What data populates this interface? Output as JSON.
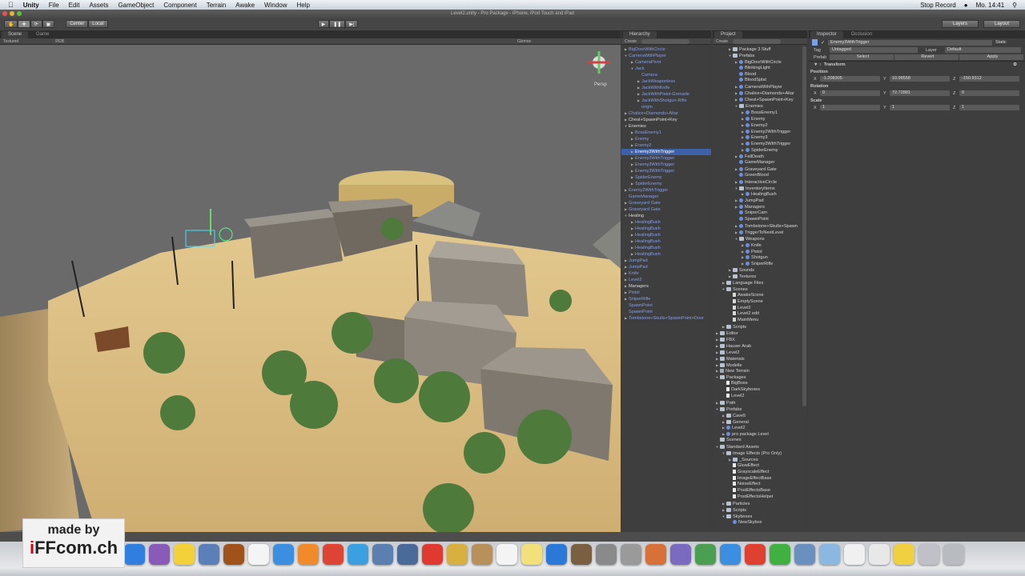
{
  "menubar": {
    "app": "Unity",
    "items": [
      "File",
      "Edit",
      "Assets",
      "GameObject",
      "Component",
      "Terrain",
      "Awake",
      "Window",
      "Help"
    ],
    "status": [
      "Stop Record",
      "Mo. 14:41"
    ]
  },
  "window": {
    "title": "Level2.unity - Pro Package - iPhone, iPod Touch and iPad"
  },
  "toolbar": {
    "pivot": "Center",
    "space": "Local",
    "layers": "Layers",
    "layout": "Layout"
  },
  "scene": {
    "tabs": [
      "Scene",
      "Game"
    ],
    "render_mode": "Textured",
    "color_mode": "RGB",
    "gizmos": "Gizmos",
    "persp": "Persp"
  },
  "hierarchy": {
    "title": "Hierarchy",
    "create": "Create",
    "items": [
      [
        0,
        "c",
        "BigDoorWithCircle",
        1
      ],
      [
        0,
        "o",
        "CameraWithPlayer",
        1
      ],
      [
        1,
        "c",
        "CameraPivot",
        1
      ],
      [
        1,
        "o",
        "Jack",
        1
      ],
      [
        2,
        "",
        "Camera",
        1
      ],
      [
        2,
        "c",
        "JackWeaponless",
        1
      ],
      [
        2,
        "c",
        "JackWithKnife",
        1
      ],
      [
        2,
        "c",
        "JackWithPistol-Grenade",
        1
      ],
      [
        2,
        "c",
        "JackWithShotgun-Rifle",
        1
      ],
      [
        2,
        "",
        "origin",
        1
      ],
      [
        0,
        "c",
        "Chalice+Diamonds+Altar",
        1
      ],
      [
        0,
        "c",
        "Chest+SpawnPoint+Key",
        0
      ],
      [
        0,
        "o",
        "Enemies",
        0
      ],
      [
        1,
        "c",
        "BossEnemy1",
        1
      ],
      [
        1,
        "c",
        "Enemy",
        1
      ],
      [
        1,
        "c",
        "Enemy2",
        1
      ],
      [
        1,
        "c",
        "Enemy3WithTrigger",
        2
      ],
      [
        1,
        "c",
        "Enemy3WithTrigger",
        1
      ],
      [
        1,
        "c",
        "Enemy3WithTrigger",
        1
      ],
      [
        1,
        "c",
        "Enemy3WithTrigger",
        1
      ],
      [
        1,
        "c",
        "SpiderEnemy",
        1
      ],
      [
        1,
        "c",
        "SpiderEnemy",
        1
      ],
      [
        0,
        "c",
        "Enemy2WithTrigger",
        1
      ],
      [
        0,
        "",
        "GameManager",
        1
      ],
      [
        0,
        "c",
        "Graveyard Gate",
        1
      ],
      [
        0,
        "c",
        "Graveyard Gate",
        1
      ],
      [
        0,
        "o",
        "Healing",
        0
      ],
      [
        1,
        "c",
        "HealingBush",
        1
      ],
      [
        1,
        "c",
        "HealingBush",
        1
      ],
      [
        1,
        "c",
        "HealingBush",
        1
      ],
      [
        1,
        "c",
        "HealingBush",
        1
      ],
      [
        1,
        "c",
        "HealingBush",
        1
      ],
      [
        1,
        "c",
        "HealingBush",
        1
      ],
      [
        0,
        "c",
        "JumpPad",
        1
      ],
      [
        0,
        "c",
        "JumpPad",
        1
      ],
      [
        0,
        "c",
        "Knife",
        1
      ],
      [
        0,
        "c",
        "Level2",
        1
      ],
      [
        0,
        "c",
        "Managers",
        0
      ],
      [
        0,
        "c",
        "Pistol",
        1
      ],
      [
        0,
        "c",
        "SniperRifle",
        1
      ],
      [
        0,
        "",
        "SpawnPoint",
        1
      ],
      [
        0,
        "",
        "SpawnPoint",
        1
      ],
      [
        0,
        "c",
        "Tombstone+Skulls+SpawnPoint+Door",
        1
      ]
    ]
  },
  "project": {
    "title": "Project",
    "create": "Create",
    "items": [
      [
        2,
        "c",
        "f",
        "Package 3 Stuff"
      ],
      [
        2,
        "o",
        "f",
        "Prefabs"
      ],
      [
        3,
        "c",
        "p",
        "BigDoorWithCircle"
      ],
      [
        3,
        "",
        "p",
        "BlinkingLight"
      ],
      [
        3,
        "",
        "p",
        "Blood"
      ],
      [
        3,
        "",
        "p",
        "BloodSplat"
      ],
      [
        3,
        "c",
        "p",
        "CameraWithPlayer"
      ],
      [
        3,
        "c",
        "p",
        "Chalice+Diamonds+Altar"
      ],
      [
        3,
        "c",
        "p",
        "Chest+SpawnPoint+Key"
      ],
      [
        3,
        "o",
        "f",
        "Enemies"
      ],
      [
        4,
        "c",
        "p",
        "BossEnemy1"
      ],
      [
        4,
        "c",
        "p",
        "Enemy"
      ],
      [
        4,
        "c",
        "p",
        "Enemy2"
      ],
      [
        4,
        "c",
        "p",
        "Enemy2WithTrigger"
      ],
      [
        4,
        "c",
        "p",
        "Enemy3"
      ],
      [
        4,
        "c",
        "p",
        "Enemy3WithTrigger"
      ],
      [
        4,
        "c",
        "p",
        "SpiderEnemy"
      ],
      [
        3,
        "c",
        "p",
        "FallDeath"
      ],
      [
        3,
        "",
        "p",
        "GameManager"
      ],
      [
        3,
        "c",
        "p",
        "Graveyard Gate"
      ],
      [
        3,
        "",
        "p",
        "GreenBlood"
      ],
      [
        3,
        "c",
        "p",
        "InteractiveCircle"
      ],
      [
        3,
        "o",
        "f",
        "InventoryItems"
      ],
      [
        4,
        "c",
        "p",
        "HealingBush"
      ],
      [
        3,
        "c",
        "p",
        "JumpPad"
      ],
      [
        3,
        "c",
        "p",
        "Managers"
      ],
      [
        3,
        "",
        "p",
        "SniperCam"
      ],
      [
        3,
        "",
        "p",
        "SpawnPoint"
      ],
      [
        3,
        "c",
        "p",
        "Tombstone+Skulls+Spawn"
      ],
      [
        3,
        "c",
        "p",
        "TriggerToNextLevel"
      ],
      [
        3,
        "o",
        "f",
        "Weapons"
      ],
      [
        4,
        "c",
        "p",
        "Knife"
      ],
      [
        4,
        "c",
        "p",
        "Pistol"
      ],
      [
        4,
        "c",
        "p",
        "Shotgun"
      ],
      [
        4,
        "c",
        "p",
        "SniperRifle"
      ],
      [
        2,
        "c",
        "f",
        "Sounds"
      ],
      [
        2,
        "c",
        "f",
        "Textures"
      ],
      [
        1,
        "c",
        "f",
        "Language Files"
      ],
      [
        1,
        "o",
        "f",
        "Scenes"
      ],
      [
        2,
        "",
        "s",
        "AwakeScene"
      ],
      [
        2,
        "",
        "s",
        "EmptyScene"
      ],
      [
        2,
        "",
        "s",
        "Level2"
      ],
      [
        2,
        "",
        "s",
        "Level2 edit"
      ],
      [
        2,
        "",
        "s",
        "MainMenu"
      ],
      [
        1,
        "c",
        "f",
        "Scripts"
      ],
      [
        0,
        "c",
        "f",
        "Editor"
      ],
      [
        0,
        "c",
        "f",
        "FBX"
      ],
      [
        0,
        "c",
        "f",
        "Hauser Arab"
      ],
      [
        0,
        "c",
        "f",
        "Level2"
      ],
      [
        0,
        "c",
        "f",
        "Materials"
      ],
      [
        0,
        "c",
        "f",
        "Modelle"
      ],
      [
        0,
        "c",
        "t",
        "New Terrain"
      ],
      [
        0,
        "o",
        "f",
        "Packages"
      ],
      [
        1,
        "",
        "d",
        "BigBoss"
      ],
      [
        1,
        "",
        "d",
        "DarkSkyboxes"
      ],
      [
        1,
        "",
        "d",
        "Level2"
      ],
      [
        0,
        "c",
        "f",
        "Path"
      ],
      [
        0,
        "o",
        "f",
        "Prefabs"
      ],
      [
        1,
        "c",
        "f",
        "Cave5"
      ],
      [
        1,
        "c",
        "f",
        "General"
      ],
      [
        1,
        "c",
        "p",
        "Level2"
      ],
      [
        1,
        "c",
        "p",
        "pro package Level"
      ],
      [
        0,
        "",
        "f",
        "Scenes"
      ],
      [
        0,
        "o",
        "f",
        "Standard Assets"
      ],
      [
        1,
        "o",
        "f",
        "Image Effects (Pro Only)"
      ],
      [
        2,
        "c",
        "f",
        "_Sources"
      ],
      [
        2,
        "",
        "d",
        "GlowEffect"
      ],
      [
        2,
        "",
        "d",
        "GrayscaleEffect"
      ],
      [
        2,
        "",
        "d",
        "ImageEffectBase"
      ],
      [
        2,
        "",
        "d",
        "NoiseEffect"
      ],
      [
        2,
        "",
        "d",
        "PostEffectsBase"
      ],
      [
        2,
        "",
        "d",
        "PostEffectsHelper"
      ],
      [
        1,
        "c",
        "f",
        "Particles"
      ],
      [
        1,
        "c",
        "f",
        "Scripts"
      ],
      [
        1,
        "o",
        "f",
        "Skyboxes"
      ],
      [
        2,
        "",
        "p",
        "NewSkybox"
      ]
    ]
  },
  "inspector": {
    "tabs": [
      "Inspector",
      "Occlusion"
    ],
    "object_name": "Enemy3WithTrigger",
    "static": "Static",
    "tag_label": "Tag",
    "tag": "Untagged",
    "layer_label": "Layer",
    "layer": "Default",
    "prefab_label": "Prefab",
    "prefab_buttons": [
      "Select",
      "Revert",
      "Apply"
    ],
    "component": "Transform",
    "position_label": "Position",
    "position": {
      "x": "-1.208305",
      "y": "10.98558",
      "z": "-150.9312"
    },
    "rotation_label": "Rotation",
    "rotation": {
      "x": "0",
      "y": "72.72881",
      "z": "0"
    },
    "scale_label": "Scale",
    "scale": {
      "x": "1",
      "y": "1",
      "z": "1"
    }
  },
  "dock": {
    "icons": [
      "app-store",
      "itunes-badge",
      "cyberduck",
      "preview",
      "diablo",
      "unity",
      "xcode",
      "pages",
      "chrome",
      "safari",
      "dashboard",
      "screen-capture",
      "flashget",
      "keychain",
      "contacts",
      "calendar",
      "stickies",
      "itunes",
      "iphoto",
      "imovie",
      "system-preferences",
      "keynote",
      "script-editor",
      "numbers",
      "word",
      "powerpoint",
      "excel",
      "unity-remote",
      "applications",
      "documents",
      "zip",
      "downloads",
      "screens",
      "trash"
    ],
    "colors": [
      "#2f7ee0",
      "#8a5ab8",
      "#f2d13a",
      "#5b7fb8",
      "#a0521b",
      "#f4f4f4",
      "#3c8fe0",
      "#f08a2a",
      "#dd4433",
      "#3aa0e0",
      "#5a7fb0",
      "#4a6a9a",
      "#e03a30",
      "#d8b040",
      "#b8905a",
      "#f4f4f4",
      "#f2e07a",
      "#2a78d8",
      "#7a6040",
      "#8a8a8a",
      "#9a9a9a",
      "#d8703a",
      "#7a6ac0",
      "#4aa050",
      "#3a8fe0",
      "#e04030",
      "#40b040",
      "#6a90c0",
      "#8ab8e0",
      "#f0f0f0",
      "#e8e8e8",
      "#f0d040",
      "#c0c0c8",
      "#b8bcc0"
    ]
  },
  "watermark": {
    "line1": "made by",
    "brand_i": "i",
    "brand_rest": "FFcom.ch"
  }
}
